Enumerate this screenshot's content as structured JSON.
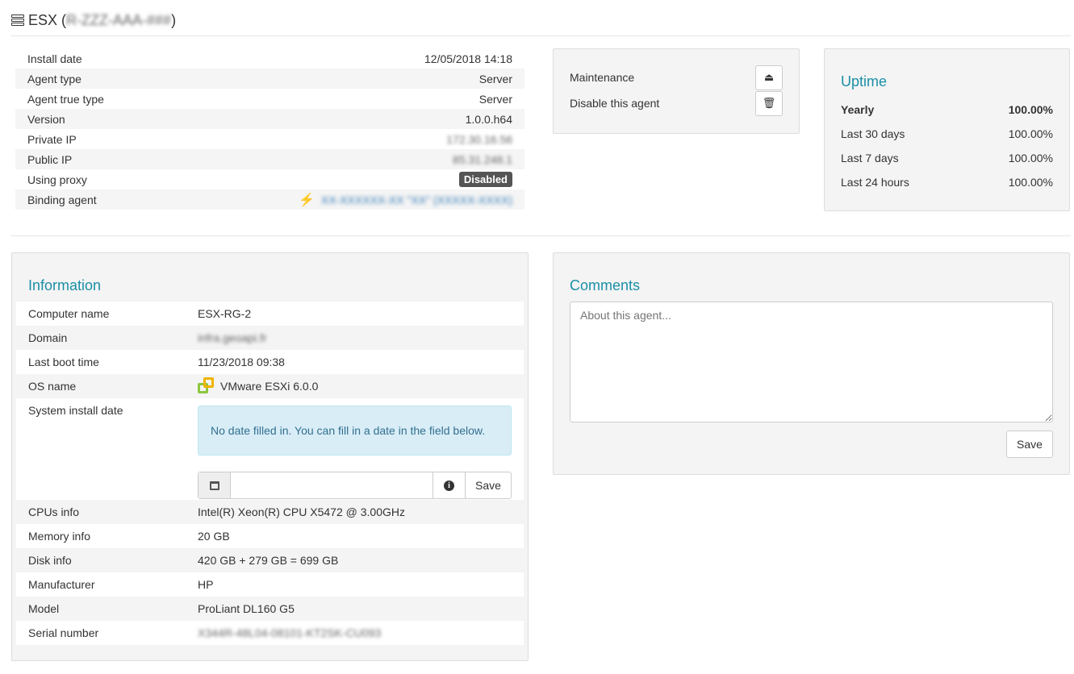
{
  "header": {
    "title": "ESX",
    "hostname_blurred": "R-ZZZ-AAA-###"
  },
  "details": [
    {
      "label": "Install date",
      "value": "12/05/2018 14:18"
    },
    {
      "label": "Agent type",
      "value": "Server"
    },
    {
      "label": "Agent true type",
      "value": "Server"
    },
    {
      "label": "Version",
      "value": "1.0.0.h64"
    },
    {
      "label": "Private IP",
      "value": "172.30.16.56"
    },
    {
      "label": "Public IP",
      "value": "85.31.248.1"
    },
    {
      "label": "Using proxy",
      "value": "Disabled"
    },
    {
      "label": "Binding agent",
      "value": "XX-XXXXXX-XX \"XX\" (XXXXX-XXXX)"
    }
  ],
  "actions": {
    "maintenance": "Maintenance",
    "disable": "Disable this agent"
  },
  "uptime": {
    "title": "Uptime",
    "rows": [
      {
        "label": "Yearly",
        "value": "100.00%"
      },
      {
        "label": "Last 30 days",
        "value": "100.00%"
      },
      {
        "label": "Last 7 days",
        "value": "100.00%"
      },
      {
        "label": "Last 24 hours",
        "value": "100.00%"
      }
    ]
  },
  "information": {
    "title": "Information",
    "computer_name": {
      "label": "Computer name",
      "value": "ESX-RG-2"
    },
    "domain": {
      "label": "Domain",
      "value": "infra.geoapi.fr"
    },
    "last_boot": {
      "label": "Last boot time",
      "value": "11/23/2018 09:38"
    },
    "os": {
      "label": "OS name",
      "value": "VMware ESXi 6.0.0"
    },
    "sys_install": {
      "label": "System install date",
      "alert": "No date filled in. You can fill in a date in the field below.",
      "save": "Save"
    },
    "cpus": {
      "label": "CPUs info",
      "value": "Intel(R) Xeon(R) CPU X5472 @ 3.00GHz"
    },
    "memory": {
      "label": "Memory info",
      "value": "20 GB"
    },
    "disk": {
      "label": "Disk info",
      "value": "420 GB + 279 GB = 699 GB"
    },
    "manufacturer": {
      "label": "Manufacturer",
      "value": "HP"
    },
    "model": {
      "label": "Model",
      "value": "ProLiant DL160 G5"
    },
    "serial": {
      "label": "Serial number",
      "value": "X344R-48L04-08101-KT2SK-CU093"
    }
  },
  "comments": {
    "title": "Comments",
    "placeholder": "About this agent...",
    "save": "Save"
  }
}
